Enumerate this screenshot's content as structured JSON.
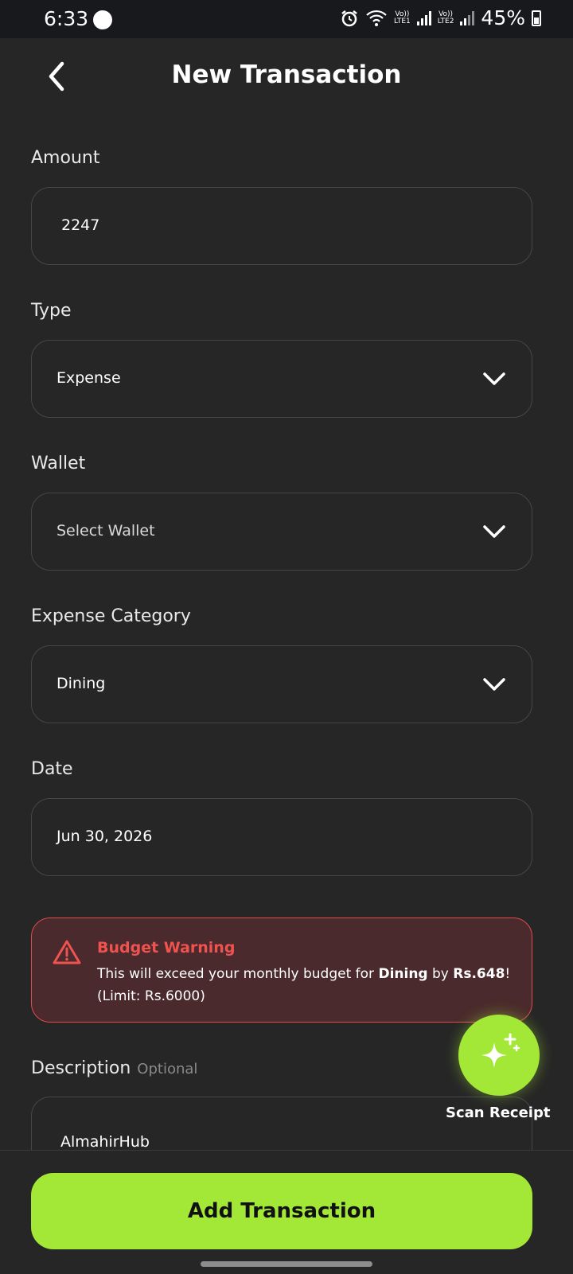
{
  "status_bar": {
    "time": "6:33",
    "battery": "45%",
    "sim1": "LTE1",
    "sim2": "LTE2",
    "volte": "Vo))"
  },
  "header": {
    "title": "New Transaction"
  },
  "form": {
    "amount": {
      "label": "Amount",
      "value": "2247"
    },
    "type": {
      "label": "Type",
      "value": "Expense"
    },
    "wallet": {
      "label": "Wallet",
      "value": "Select Wallet"
    },
    "category": {
      "label": "Expense Category",
      "value": "Dining"
    },
    "date": {
      "label": "Date",
      "value": "Jun 30, 2026"
    },
    "description": {
      "label": "Description",
      "optional": "Optional",
      "value": "AlmahirHub"
    }
  },
  "warning": {
    "title": "Budget Warning",
    "text_before": "This will exceed your monthly budget for ",
    "category": "Dining",
    "text_mid": " by ",
    "amount": "Rs.648",
    "text_after": "! (Limit: Rs.6000)"
  },
  "fab": {
    "label": "Scan Receipt",
    "icon": "sparkle-icon"
  },
  "actions": {
    "submit_label": "Add Transaction"
  },
  "colors": {
    "background": "#262626",
    "accent": "#a4e837",
    "warning": "#ef5350",
    "border": "#474747"
  }
}
